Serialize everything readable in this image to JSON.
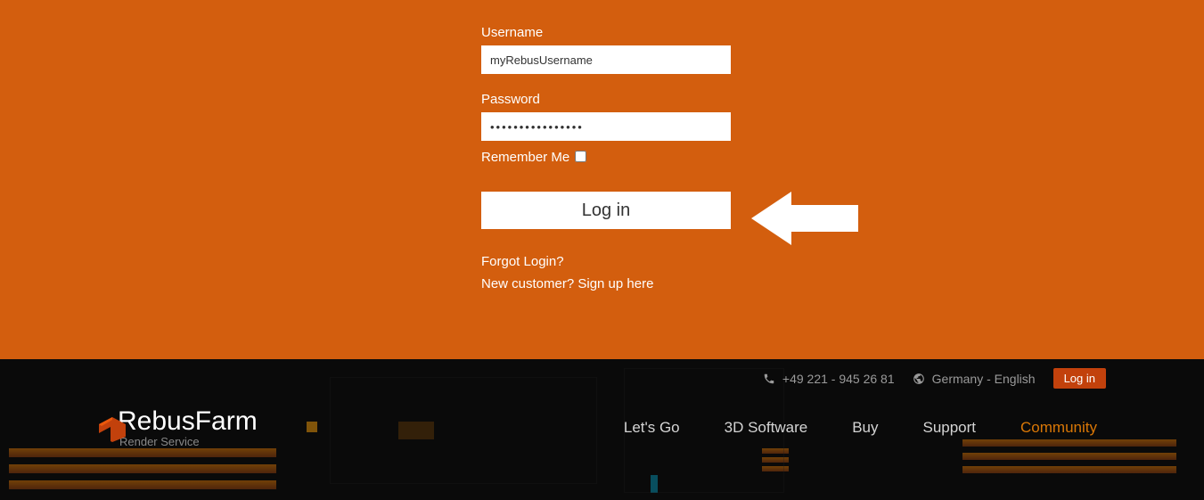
{
  "login_form": {
    "username_label": "Username",
    "username_value": "myRebusUsername",
    "password_label": "Password",
    "password_value": "••••••••••••••••",
    "remember_label": "Remember Me",
    "login_button": "Log in",
    "forgot_link": "Forgot Login?",
    "signup_link": "New customer? Sign up here"
  },
  "footer": {
    "phone": "+49 221 - 945 26 81",
    "locale": "Germany - English",
    "login_btn": "Log in",
    "logo_main": "Rebus",
    "logo_secondary": "Farm",
    "logo_tagline": "Render Service",
    "nav": {
      "letsgo": "Let's Go",
      "software": "3D Software",
      "buy": "Buy",
      "support": "Support",
      "community": "Community"
    }
  }
}
